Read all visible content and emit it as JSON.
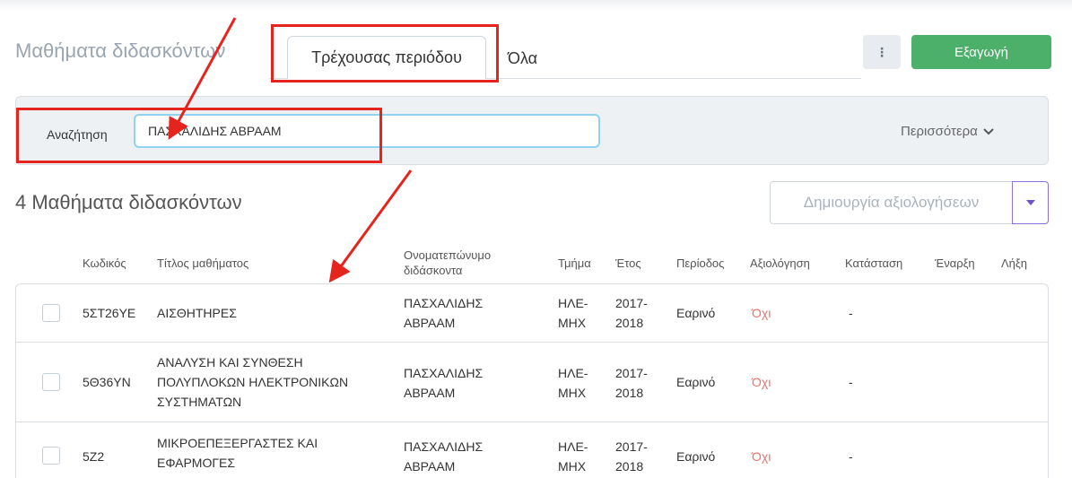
{
  "header": {
    "title": "Μαθήματα διδασκόντων",
    "tabs": [
      {
        "label": "Τρέχουσας περιόδου",
        "active": true
      },
      {
        "label": "Όλα",
        "active": false
      }
    ],
    "menu_icon": "kebab-menu-icon",
    "export_label": "Εξαγωγή"
  },
  "search": {
    "label": "Αναζήτηση",
    "value": "ΠΑΣΧΑΛΙΔΗΣ ΑΒΡΑΑΜ",
    "more_label": "Περισσότερα"
  },
  "results": {
    "title": "4 Μαθήματα διδασκόντων",
    "create_eval_label": "Δημιουργία αξιολογήσεων"
  },
  "table": {
    "columns": {
      "code": "Κωδικός",
      "course_title": "Τίτλος μαθήματος",
      "instructor_line1": "Ονοματεπώνυμο",
      "instructor_line2": "διδάσκοντα",
      "department": "Τμήμα",
      "year": "Έτος",
      "period": "Περίοδος",
      "evaluation": "Αξιολόγηση",
      "status": "Κατάσταση",
      "start": "Έναρξη",
      "end": "Λήξη"
    },
    "rows": [
      {
        "code": "5ΣΤ26ΥΕ",
        "title_lines": [
          "ΑΙΣΘΗΤΗΡΕΣ"
        ],
        "instructor_lines": [
          "ΠΑΣΧΑΛΙΔΗΣ",
          "ΑΒΡΑΑΜ"
        ],
        "department_lines": [
          "ΗΛΕ-",
          "ΜΗΧ"
        ],
        "year_lines": [
          "2017-",
          "2018"
        ],
        "period": "Εαρινό",
        "evaluation": "Όχι",
        "status": "-"
      },
      {
        "code": "5Θ36ΥΝ",
        "title_lines": [
          "ΑΝΑΛΥΣΗ ΚΑΙ ΣΥΝΘΕΣΗ",
          "ΠΟΛΥΠΛΟΚΩΝ ΗΛΕΚΤΡΟΝΙΚΩΝ",
          "ΣΥΣΤΗΜΑΤΩΝ"
        ],
        "instructor_lines": [
          "ΠΑΣΧΑΛΙΔΗΣ",
          "ΑΒΡΑΑΜ"
        ],
        "department_lines": [
          "ΗΛΕ-",
          "ΜΗΧ"
        ],
        "year_lines": [
          "2017-",
          "2018"
        ],
        "period": "Εαρινό",
        "evaluation": "Όχι",
        "status": "-"
      },
      {
        "code": "5Ζ2",
        "title_lines": [
          "ΜΙΚΡΟΕΠΕΞΕΡΓΑΣΤΕΣ ΚΑΙ",
          "ΕΦΑΡΜΟΓΕΣ"
        ],
        "instructor_lines": [
          "ΠΑΣΧΑΛΙΔΗΣ",
          "ΑΒΡΑΑΜ"
        ],
        "department_lines": [
          "ΗΛΕ-",
          "ΜΗΧ"
        ],
        "year_lines": [
          "2017-",
          "2018"
        ],
        "period": "Εαρινό",
        "evaluation": "Όχι",
        "status": "-"
      }
    ]
  },
  "colors": {
    "export_button": "#4caf6a",
    "evaluation_no": "#e8736b",
    "annotation": "#e5241e",
    "search_focus_border": "#8fd3f0"
  }
}
